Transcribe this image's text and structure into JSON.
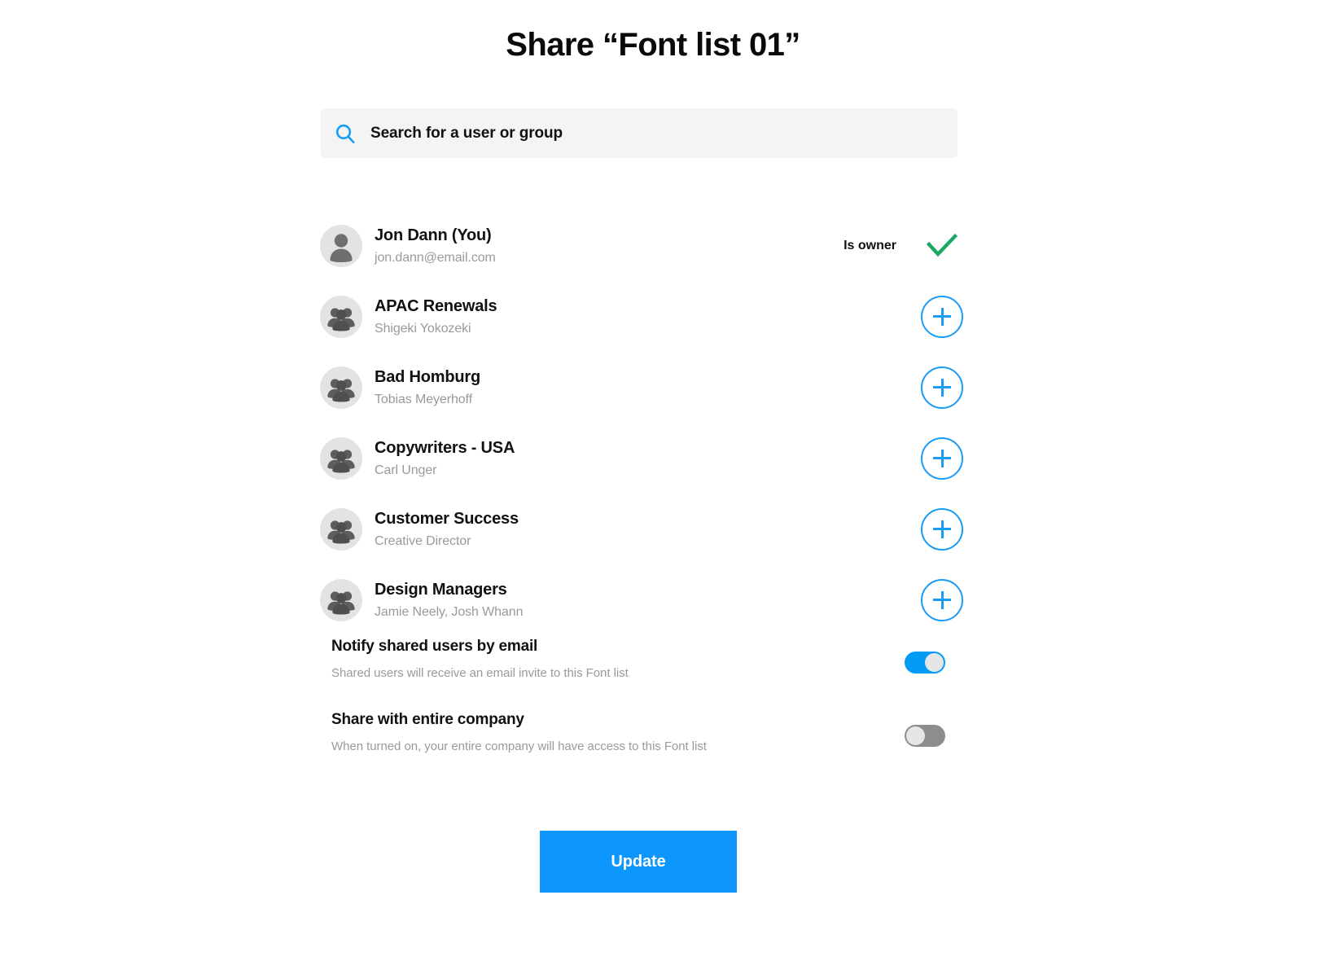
{
  "dialog": {
    "title": "Share “Font list 01”"
  },
  "search": {
    "placeholder": "Search for a user or group",
    "value": "",
    "icon": "search-icon"
  },
  "people": [
    {
      "name": "Jon Dann (You)",
      "sub": "jon.dann@email.com",
      "avatar_icon": "person-icon",
      "type": "user",
      "action": "owner",
      "owner_label": "Is owner",
      "action_icon": "check-icon"
    },
    {
      "name": "APAC Renewals",
      "sub": "Shigeki Yokozeki",
      "avatar_icon": "group-icon",
      "type": "group",
      "action": "add",
      "action_icon": "plus-icon"
    },
    {
      "name": "Bad Homburg",
      "sub": "Tobias Meyerhoff",
      "avatar_icon": "group-icon",
      "type": "group",
      "action": "add",
      "action_icon": "plus-icon"
    },
    {
      "name": "Copywriters - USA",
      "sub": "Carl Unger",
      "avatar_icon": "group-icon",
      "type": "group",
      "action": "add",
      "action_icon": "plus-icon"
    },
    {
      "name": "Customer Success",
      "sub": "Creative Director",
      "avatar_icon": "group-icon",
      "type": "group",
      "action": "add",
      "action_icon": "plus-icon"
    },
    {
      "name": "Design Managers",
      "sub": "Jamie Neely, Josh Whann",
      "avatar_icon": "group-icon",
      "type": "group",
      "action": "add",
      "action_icon": "plus-icon"
    }
  ],
  "settings": {
    "notify": {
      "title": "Notify shared users by email",
      "description": "Shared users will receive an email invite to this Font list",
      "state": "on"
    },
    "company": {
      "title": "Share with entire company",
      "description": "When turned on, your entire company will have access to this Font list",
      "state": "off"
    }
  },
  "footer": {
    "update_label": "Update"
  },
  "colors": {
    "accent_blue": "#0d96fb",
    "icon_blue": "#1a9bf5",
    "toggle_on": "#029cf5",
    "toggle_off": "#8d8d8d",
    "check_green": "#1aa863",
    "search_bg": "#f4f4f4",
    "avatar_bg": "#e3e3e3",
    "muted_text": "#9a9a9a"
  }
}
